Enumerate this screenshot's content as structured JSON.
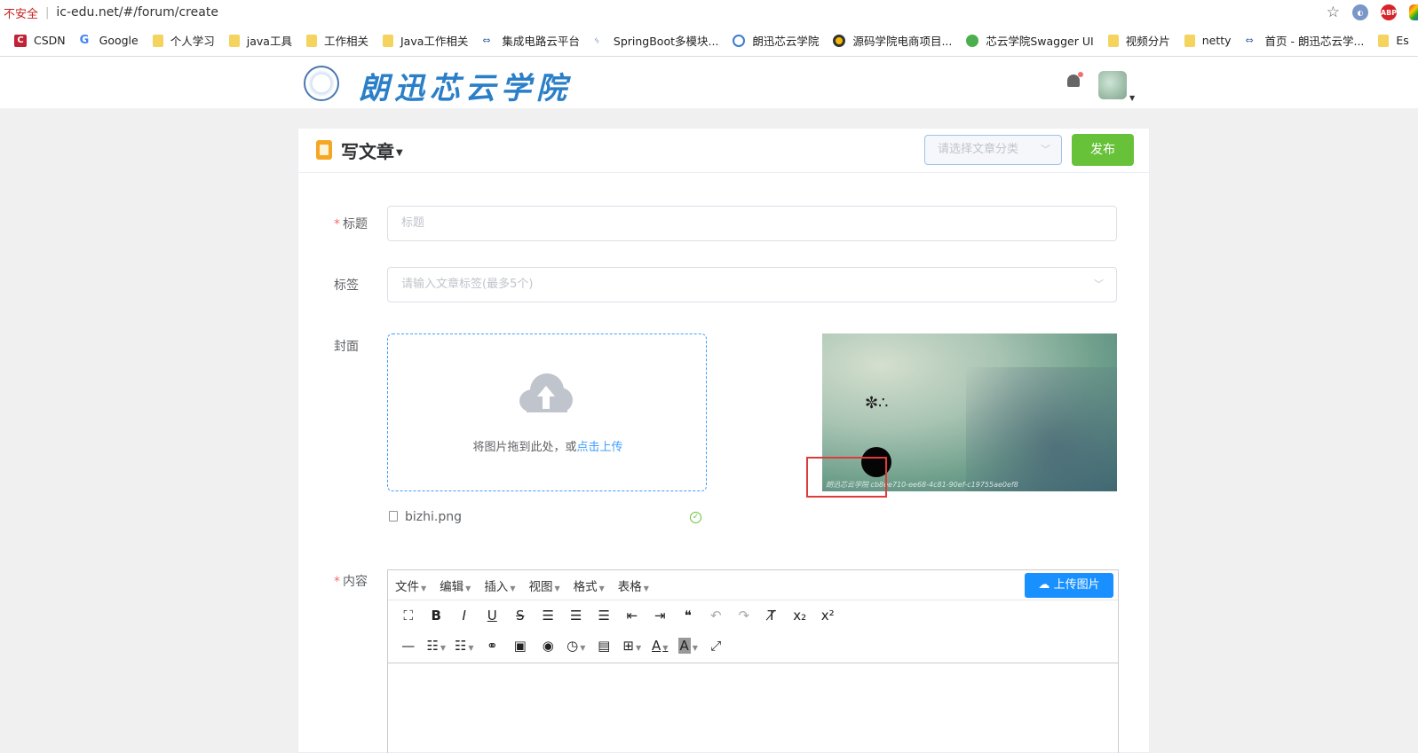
{
  "browser": {
    "insecure_label": "不安全",
    "url": "ic-edu.net/#/forum/create",
    "bookmarks": [
      {
        "label": "CSDN",
        "icon": "csdn-icon"
      },
      {
        "label": "Google",
        "icon": "google-icon"
      },
      {
        "label": "个人学习",
        "icon": "folder-icon"
      },
      {
        "label": "java工具",
        "icon": "folder-icon"
      },
      {
        "label": "工作相关",
        "icon": "folder-icon"
      },
      {
        "label": "Java工作相关",
        "icon": "folder-icon"
      },
      {
        "label": "集成电路云平台",
        "icon": "link-icon"
      },
      {
        "label": "SpringBoot多模块...",
        "icon": "link-icon"
      },
      {
        "label": "朗迅芯云学院",
        "icon": "site-icon"
      },
      {
        "label": "源码学院电商项目...",
        "icon": "site-icon"
      },
      {
        "label": "芯云学院Swagger UI",
        "icon": "swagger-icon"
      },
      {
        "label": "视频分片",
        "icon": "folder-icon"
      },
      {
        "label": "netty",
        "icon": "folder-icon"
      },
      {
        "label": "首页 - 朗迅芯云学...",
        "icon": "link-icon"
      },
      {
        "label": "Es",
        "icon": "folder-icon"
      }
    ]
  },
  "site": {
    "logo_text": "朗迅芯云学院"
  },
  "page": {
    "title": "写文章",
    "category_placeholder": "请选择文章分类",
    "publish_label": "发布"
  },
  "form": {
    "title_label": "标题",
    "title_placeholder": "标题",
    "tags_label": "标签",
    "tags_placeholder": "请输入文章标签(最多5个)",
    "cover_label": "封面",
    "upload_hint": "将图片拖到此处，或",
    "upload_link": "点击上传",
    "file_name": "bizhi.png",
    "content_label": "内容",
    "preview_watermark": "朗迅芯云学院 cb8ee710-ee68-4c81-90ef-c19755ae0ef8"
  },
  "editor": {
    "menus": [
      "文件",
      "编辑",
      "插入",
      "视图",
      "格式",
      "表格"
    ],
    "upload_image_label": "上传图片"
  },
  "colors": {
    "accent": "#409eff",
    "publish": "#67c23a",
    "required": "#f56c6c",
    "highlight_box": "#e03b3b"
  }
}
